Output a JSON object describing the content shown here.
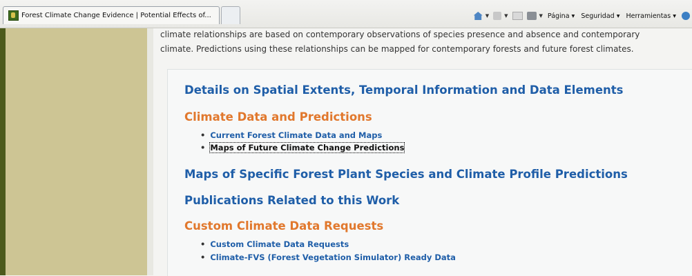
{
  "browser": {
    "tab_title": "Forest Climate Change Evidence | Potential Effects of...",
    "commands": {
      "page": "Página",
      "security": "Seguridad",
      "tools": "Herramientas"
    }
  },
  "content": {
    "intro_line1": "climate relationships are based on contemporary observations of species presence and absence and contemporary",
    "intro_line2": "climate. Predictions using these relationships can be mapped for contemporary forests and future forest climates.",
    "sections": {
      "details": "Details on Spatial Extents, Temporal Information and Data Elements",
      "climate_data": "Climate Data and Predictions",
      "climate_links": [
        "Current Forest Climate Data and Maps",
        "Maps of Future Climate Change Predictions"
      ],
      "maps_species": "Maps of Specific Forest Plant Species and Climate Profile Predictions",
      "publications": "Publications Related to this Work",
      "custom_requests": "Custom Climate Data Requests",
      "custom_links": [
        "Custom Climate Data Requests",
        "Climate-FVS (Forest Vegetation Simulator) Ready Data"
      ]
    }
  },
  "colors": {
    "link_blue": "#1f5ea8",
    "heading_orange": "#e1782d",
    "sidebar": "#cdc594",
    "sidebar_dark": "#4c5a1c"
  }
}
